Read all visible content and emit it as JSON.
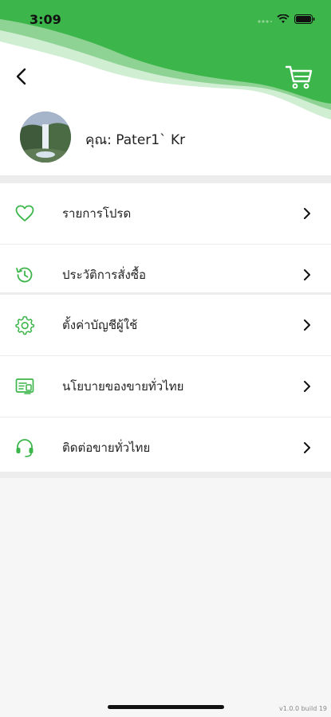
{
  "status_bar": {
    "time": "3:09"
  },
  "colors": {
    "accent": "#3cb64a",
    "accent_light": "#bfe6c3",
    "icon": "#3cb64a"
  },
  "profile": {
    "name": "คุณ: Pater1` Kr"
  },
  "menu": {
    "group1": [
      {
        "label": "รายการโปรด",
        "icon": "heart-icon"
      },
      {
        "label": "ประวัติการสั่งซื้อ",
        "icon": "history-icon"
      }
    ],
    "group2": [
      {
        "label": "ตั้งค่าบัญชีผู้ใช้",
        "icon": "gear-icon"
      },
      {
        "label": "นโยบายของขายทั่วไทย",
        "icon": "policy-icon"
      },
      {
        "label": "ติดต่อขายทั่วไทย",
        "icon": "headset-icon"
      }
    ]
  },
  "footer": {
    "version": "v1.0.0 build 19"
  }
}
